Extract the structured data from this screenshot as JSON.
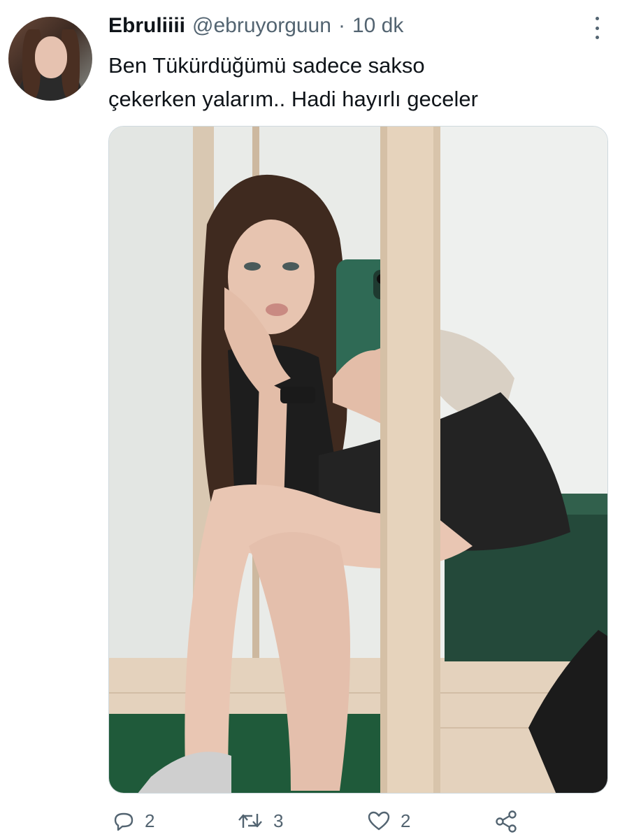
{
  "tweet": {
    "author": {
      "display_name": "Ebruliiii",
      "handle": "@ebruyorguun",
      "separator": "·",
      "time": "10 dk"
    },
    "text_lines": [
      "Ben Tükürdüğümü sadece sakso",
      "çekerken yalarım.. Hadi hayırlı geceler"
    ],
    "actions": {
      "reply_count": "2",
      "retweet_count": "3",
      "like_count": "2"
    }
  },
  "icons": {
    "more": "more-options-icon",
    "reply": "reply-icon",
    "retweet": "retweet-icon",
    "like": "like-icon",
    "share": "share-icon"
  },
  "colors": {
    "text_primary": "#0f1419",
    "text_secondary": "#536471",
    "border": "#cfd9de"
  }
}
